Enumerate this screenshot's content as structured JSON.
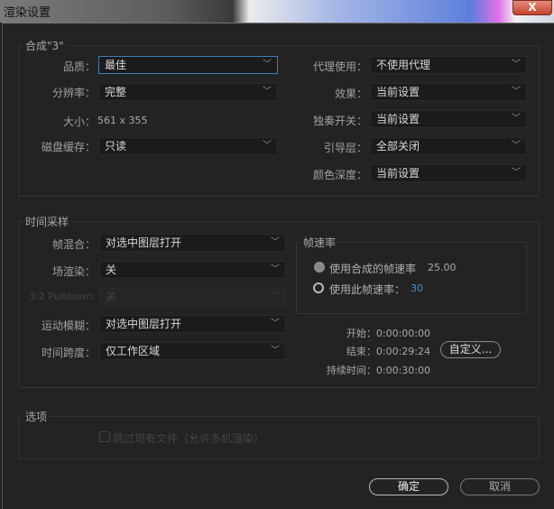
{
  "window": {
    "title": "渲染设置",
    "close_label": "X"
  },
  "composition": {
    "group_label": "合成\"3\"",
    "quality": {
      "label": "品质：",
      "value": "最佳"
    },
    "resolution": {
      "label": "分辨率：",
      "value": "完整"
    },
    "size": {
      "label": "大小：",
      "value": "561 x 355"
    },
    "disk_cache": {
      "label": "磁盘缓存：",
      "value": "只读"
    },
    "proxy_use": {
      "label": "代理使用：",
      "value": "不使用代理"
    },
    "effects": {
      "label": "效果：",
      "value": "当前设置"
    },
    "solo_switches": {
      "label": "独奏开关：",
      "value": "当前设置"
    },
    "guide_layers": {
      "label": "引导层：",
      "value": "全部关闭"
    },
    "color_depth": {
      "label": "颜色深度：",
      "value": "当前设置"
    }
  },
  "time_sampling": {
    "group_label": "时间采样",
    "frame_blending": {
      "label": "帧混合：",
      "value": "对选中图层打开"
    },
    "field_render": {
      "label": "场渲染：",
      "value": "关"
    },
    "pulldown": {
      "label": "3:2 Pulldown:",
      "value": "关"
    },
    "motion_blur": {
      "label": "运动模糊：",
      "value": "对选中图层打开"
    },
    "time_span": {
      "label": "时间跨度：",
      "value": "仅工作区域"
    },
    "frame_rate": {
      "group_label": "帧速率",
      "use_comp_label": "使用合成的帧速率",
      "comp_rate": "25.00",
      "use_this_label": "使用此帧速率：",
      "this_rate": "30",
      "selected": "use_this"
    },
    "start": "开始：0:00:00:00",
    "end": "结束：0:00:29:24",
    "duration": "持续时间：0:00:30:00",
    "custom_button": "自定义..."
  },
  "options": {
    "group_label": "选项",
    "skip_existing": {
      "label": "跳过现有文件（允许多机渲染）",
      "checked": false
    }
  },
  "footer": {
    "ok": "确定",
    "cancel": "取消"
  }
}
